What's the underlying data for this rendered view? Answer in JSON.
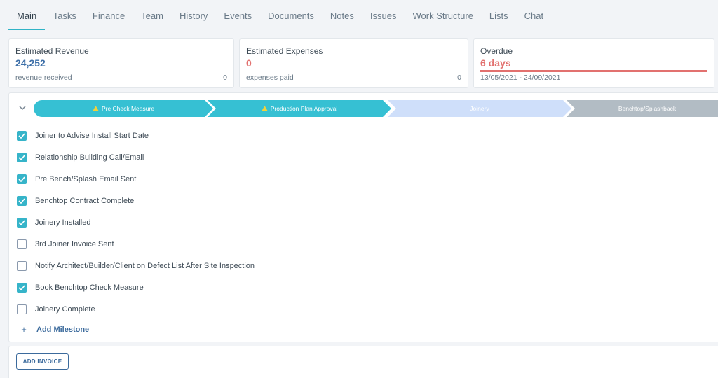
{
  "tabs": [
    {
      "label": "Main",
      "active": true
    },
    {
      "label": "Tasks"
    },
    {
      "label": "Finance"
    },
    {
      "label": "Team"
    },
    {
      "label": "History"
    },
    {
      "label": "Events"
    },
    {
      "label": "Documents"
    },
    {
      "label": "Notes"
    },
    {
      "label": "Issues"
    },
    {
      "label": "Work Structure"
    },
    {
      "label": "Lists"
    },
    {
      "label": "Chat"
    }
  ],
  "cards": {
    "revenue": {
      "title": "Estimated Revenue",
      "value": "24,252",
      "sub": "revenue received",
      "count": "0",
      "color": "#3d6fa8"
    },
    "expenses": {
      "title": "Estimated Expenses",
      "value": "0",
      "sub": "expenses paid",
      "count": "0",
      "color": "#e2716f"
    },
    "overdue": {
      "title": "Overdue",
      "value": "6 days",
      "dates": "13/05/2021 - 24/09/2021",
      "color": "#e2716f"
    }
  },
  "stages": [
    {
      "label": "Pre Check Measure",
      "warning": true,
      "color": "#36c0d3"
    },
    {
      "label": "Production Plan Approval",
      "warning": true,
      "color": "#36c0d3"
    },
    {
      "label": "Joinery",
      "warning": false,
      "color": "#cfdffa"
    },
    {
      "label": "Benchtop/Splashback",
      "warning": false,
      "color": "#b2bcc4"
    }
  ],
  "milestones": [
    {
      "label": "Joiner to Advise Install Start Date",
      "checked": true
    },
    {
      "label": "Relationship Building Call/Email",
      "checked": true
    },
    {
      "label": "Pre Bench/Splash Email Sent",
      "checked": true
    },
    {
      "label": "Benchtop Contract Complete",
      "checked": true
    },
    {
      "label": "Joinery Installed",
      "checked": true
    },
    {
      "label": "3rd Joiner Invoice Sent",
      "checked": false
    },
    {
      "label": "Notify Architect/Builder/Client on Defect List After Site Inspection",
      "checked": false
    },
    {
      "label": "Book Benchtop Check Measure",
      "checked": true
    },
    {
      "label": "Joinery Complete",
      "checked": false
    }
  ],
  "add_milestone": {
    "label": "Add Milestone"
  },
  "add_invoice": {
    "label": "ADD INVOICE"
  },
  "icons": {
    "collapse": "chevron-down-icon",
    "warning": "warning-icon",
    "check": "check-icon",
    "plus": "plus-icon"
  }
}
